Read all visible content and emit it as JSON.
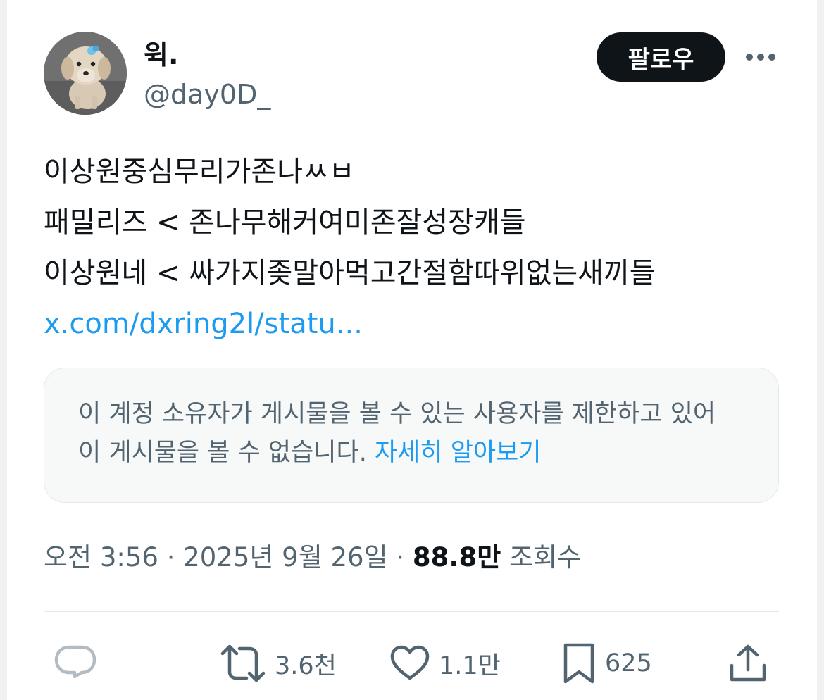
{
  "author": {
    "display_name": "윅.",
    "handle": "@day0D_"
  },
  "follow_label": "팔로우",
  "more_icon": "more-horizontal-icon",
  "tweet": {
    "lines": [
      "이상원중심무리가존나ㅆㅂ",
      "패밀리즈 < 존나무해커여미존잘성장캐들",
      "이상원네 < 싸가지좆말아먹고간절함따위없는새끼들"
    ],
    "link": "x.com/dxring2l/statu..."
  },
  "notice": {
    "text": "이 계정 소유자가 게시물을 볼 수 있는 사용자를 제한하고 있어 이 게시물을 볼 수 없습니다. ",
    "link": "자세히 알아보기"
  },
  "meta": {
    "time_date": "오전 3:56 · 2025년 9월 26일 · ",
    "views_count": "88.8만",
    "views_label": " 조회수"
  },
  "actions": {
    "reply": {
      "icon": "reply-icon"
    },
    "retweet": {
      "icon": "retweet-icon",
      "count": "3.6천"
    },
    "like": {
      "icon": "heart-icon",
      "count": "1.1만"
    },
    "bookmark": {
      "icon": "bookmark-icon",
      "count": "625"
    },
    "share": {
      "icon": "share-icon"
    }
  },
  "colors": {
    "text_primary": "#0f1419",
    "text_secondary": "#536471",
    "link": "#1d9bf0",
    "notice_bg": "#f7f9f9",
    "follow_bg": "#0f1419"
  }
}
